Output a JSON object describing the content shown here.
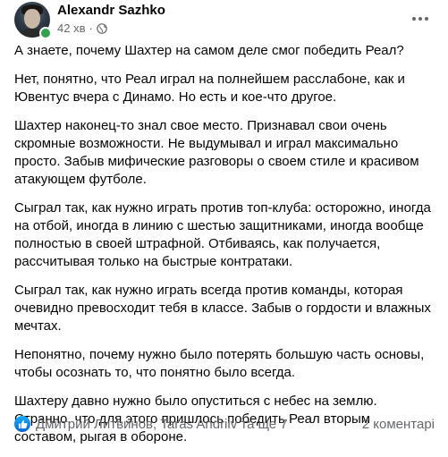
{
  "post": {
    "author": "Alexandr Sazhko",
    "time": "42 хв",
    "separator": "·",
    "paragraphs": [
      "А знаете, почему Шахтер на самом деле смог победить Реал?",
      "Нет, понятно, что Реал играл на полнейшем расслабоне, как и Ювентус вчера с Динамо. Но есть и кое-что другое.",
      "Шахтер наконец-то знал свое место. Признавал свои очень скромные возможности. Не выдумывал и играл максимально просто. Забыв мифические разговоры о своем стиле и красивом атакующем футболе.",
      "Сыграл так, как нужно играть против топ-клуба: осторожно, иногда на отбой, иногда в линию с шестью защитниками, иногда вообще полностью в своей штрафной. Отбиваясь, как получается, рассчитывая только на быстрые контратаки.",
      "Сыграл так, как нужно играть всегда против команды, которая очевидно превосходит тебя в классе. Забыв о гордости и влажных мечтах.",
      "Непонятно, почему нужно было потерять большую часть основы, чтобы осознать то, что понятно было всегда.",
      "Шахтеру давно нужно было опуститься с небес на землю. Странно, что для этого пришлось победить Реал вторым составом, рыгая в обороне."
    ],
    "reactions_text": "Дмитрий Литвинов, Taras Andriiv та ще 7",
    "comments_text": "2 коментарі",
    "icons": {
      "avatar": "avatar",
      "more": "more-horizontal-icon",
      "audience": "globe-icon",
      "reaction": "like-icon"
    },
    "colors": {
      "text": "#050505",
      "secondary": "#65676b",
      "like": "#1877f2",
      "online": "#31a24c"
    }
  }
}
